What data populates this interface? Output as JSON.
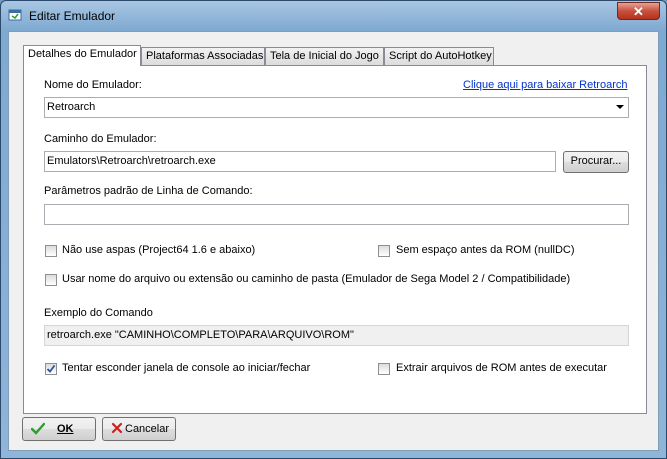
{
  "window": {
    "title": "Editar Emulador",
    "close_glyph": "✕"
  },
  "tabs": [
    {
      "label": "Detalhes do Emulador"
    },
    {
      "label": "Plataformas Associadas"
    },
    {
      "label": "Tela de Inicial do Jogo"
    },
    {
      "label": "Script do AutoHotkey"
    }
  ],
  "form": {
    "name_label": "Nome do Emulador:",
    "download_link": "Clique aqui para baixar Retroarch",
    "name_value": "Retroarch",
    "path_label": "Caminho do Emulador:",
    "path_value": "Emulators\\Retroarch\\retroarch.exe",
    "browse_label": "Procurar...",
    "params_label": "Parâmetros padrão de Linha de Comando:",
    "params_value": "",
    "chk_no_quotes": {
      "label": "Não use aspas (Project64 1.6 e abaixo)",
      "checked": false
    },
    "chk_no_space": {
      "label": "Sem espaço antes da ROM (nullDC)",
      "checked": false
    },
    "chk_filename": {
      "label": "Usar nome do arquivo ou extensão ou caminho de pasta (Emulador de Sega Model 2 / Compatibilidade)",
      "checked": false
    },
    "example_label": "Exemplo do Comando",
    "example_value": "retroarch.exe \"CAMINHO\\COMPLETO\\PARA\\ARQUIVO\\ROM\"",
    "chk_hide_console": {
      "label": "Tentar esconder janela de console ao iniciar/fechar",
      "checked": true
    },
    "chk_extract": {
      "label": "Extrair arquivos de ROM antes de executar",
      "checked": false
    }
  },
  "buttons": {
    "ok_label": "OK",
    "cancel_label": "Cancelar"
  },
  "icons": {
    "window": "window-app-icon",
    "ok": "green-checkmark-icon",
    "cancel": "red-x-icon",
    "dropdown": "chevron-down-icon"
  },
  "colors": {
    "link": "#0033cc",
    "ok_icon": "#2e9d2e",
    "cancel_icon": "#d02020",
    "check": "#3050a0"
  }
}
